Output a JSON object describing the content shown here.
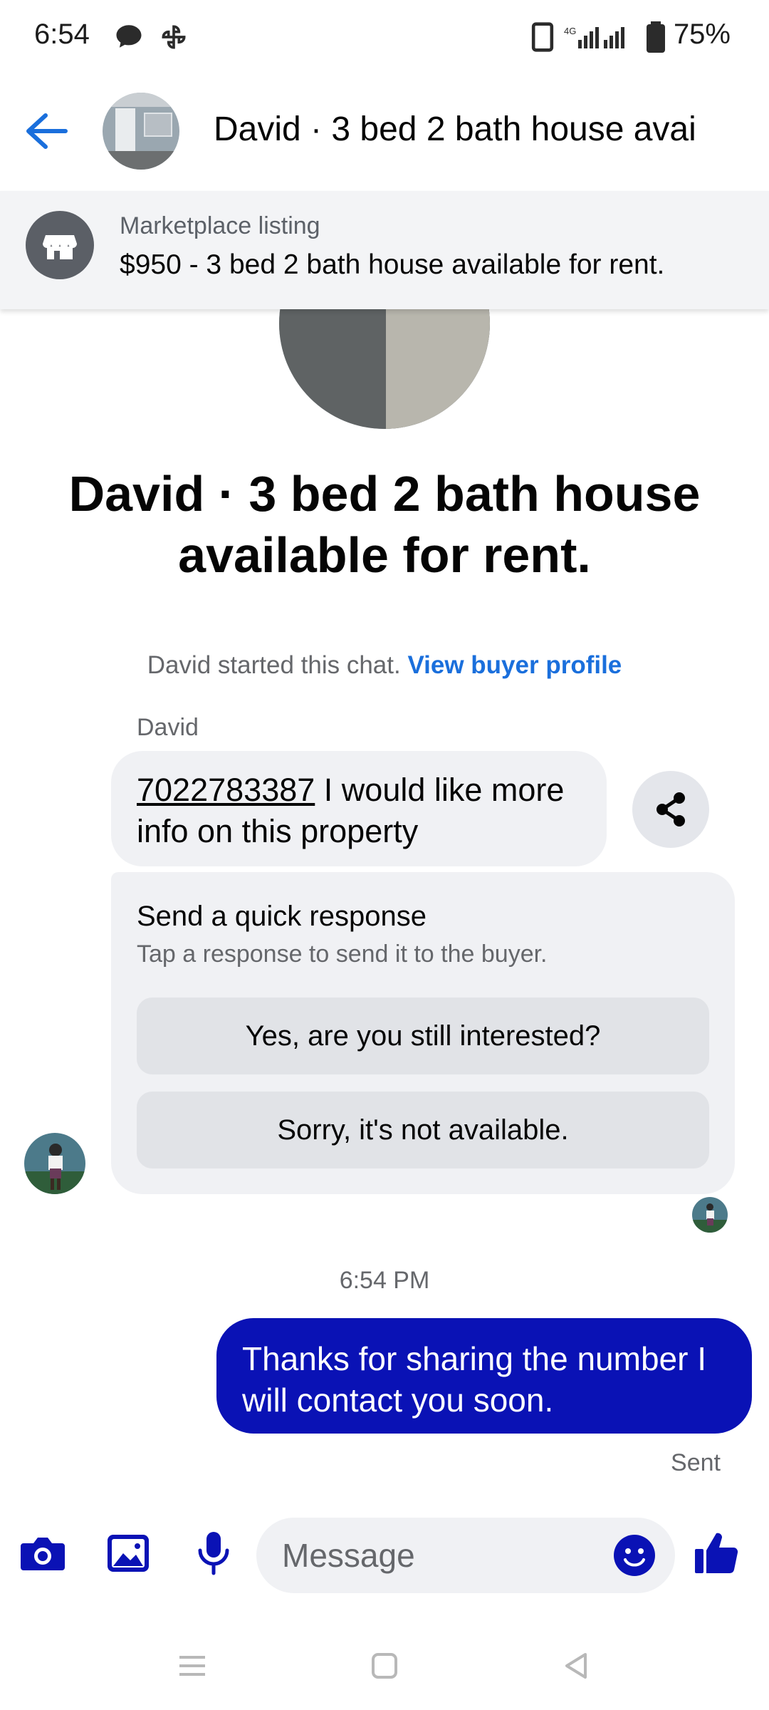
{
  "status_bar": {
    "time": "6:54",
    "network": "4G",
    "battery": "75%"
  },
  "header": {
    "title": "David · 3 bed 2 bath house avai"
  },
  "listing": {
    "kicker": "Marketplace listing",
    "title": "$950 - 3 bed 2 bath house available for rent."
  },
  "hero": {
    "title": "David · 3 bed 2 bath house available for rent."
  },
  "chat": {
    "started_text": "David started this chat.",
    "view_profile": "View buyer profile",
    "sender_name": "David",
    "incoming_phone": "7022783387",
    "incoming_text": " I would like more info on this property",
    "quick_response": {
      "title": "Send a quick response",
      "subtitle": "Tap a response to send it to the buyer.",
      "options": [
        "Yes, are you still interested?",
        "Sorry, it's not available."
      ]
    },
    "timestamp": "6:54 PM",
    "outgoing_text": "Thanks for sharing the number I will contact you soon.",
    "sent_status": "Sent"
  },
  "composer": {
    "placeholder": "Message"
  },
  "colors": {
    "accent": "#0a12b5",
    "link": "#1a6fdc",
    "bubble_bg": "#f0f1f4"
  }
}
